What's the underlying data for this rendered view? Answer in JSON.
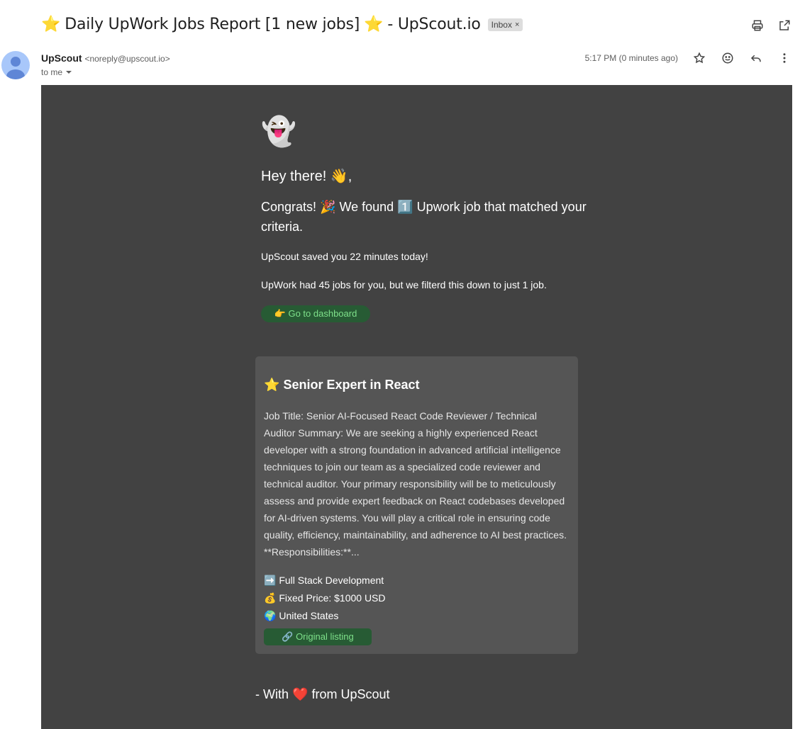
{
  "email": {
    "subject_star_left": "⭐",
    "subject": "Daily UpWork Jobs Report [1 new jobs]",
    "subject_star_right": "⭐",
    "subject_suffix": "- UpScout.io",
    "label": "Inbox",
    "label_close": "×",
    "sender_name": "UpScout",
    "sender_email": "<noreply@upscout.io>",
    "recipient": "to me",
    "time": "5:17 PM (0 minutes ago)"
  },
  "icons": {
    "print": "print-icon",
    "open_new": "open-in-new-icon",
    "star": "star-icon",
    "emoji": "emoji-icon",
    "reply": "reply-icon",
    "more": "more-vert-icon"
  },
  "body": {
    "ghost": "👻",
    "greeting": "Hey there! 👋,",
    "congrats": "Congrats! 🎉 We found 1️⃣ Upwork job that matched your criteria.",
    "saved": "UpScout saved you 22 minutes today!",
    "filtered": "UpWork had 45 jobs for you, but we filterd this down to just 1 job.",
    "dashboard_button": "👉 Go to dashboard",
    "signoff_prefix": "- With",
    "signoff_heart": "❤️",
    "signoff_suffix": "from UpScout"
  },
  "job": {
    "star": "⭐",
    "title": "Senior Expert in React",
    "description": "Job Title: Senior AI-Focused React Code Reviewer / Technical Auditor Summary: We are seeking a highly experienced React developer with a strong foundation in advanced artificial intelligence techniques to join our team as a specialized code reviewer and technical auditor. Your primary responsibility will be to meticulously assess and provide expert feedback on React codebases developed for AI-driven systems.  You will play a critical role in ensuring code quality, efficiency, maintainability, and adherence to AI best practices. **Responsibilities:**...",
    "category_icon": "➡️",
    "category": "Full Stack Development",
    "price_icon": "💰",
    "price": "Fixed Price: $1000 USD",
    "location_icon": "🌍",
    "location": "United States",
    "listing_button": "🔗 Original listing"
  }
}
